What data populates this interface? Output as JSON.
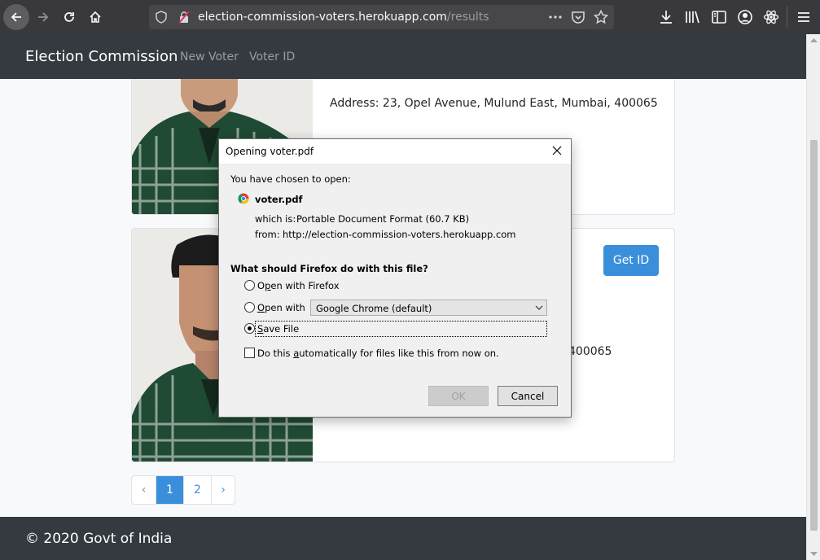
{
  "browser": {
    "url_host": "election-commission-voters.herokuapp.com",
    "url_path": "/results"
  },
  "navbar": {
    "brand": "Election Commission",
    "links": [
      "New Voter",
      "Voter ID"
    ]
  },
  "cards": [
    {
      "address": "Address: 23, Opel Avenue, Mulund East, Mumbai, 400065"
    },
    {
      "get_id_label": "Get ID",
      "address_tail": "400065"
    }
  ],
  "pagination": {
    "prev": "‹",
    "pages": [
      "1",
      "2"
    ],
    "active_page": "1",
    "next": "›"
  },
  "footer": {
    "text": "© 2020 Govt of India"
  },
  "dialog": {
    "title": "Opening voter.pdf",
    "chosen_text": "You have chosen to open:",
    "filename": "voter.pdf",
    "which_is_label": "which is:",
    "which_is_value": "Portable Document Format (60.7 KB)",
    "from_label": "from:",
    "from_value": "http://election-commission-voters.herokuapp.com",
    "question": "What should Firefox do with this file?",
    "option_open_firefox_pre": "O",
    "option_open_firefox_ul": "p",
    "option_open_firefox_post": "en with Firefox",
    "option_open_with_ul": "O",
    "option_open_with_post": "pen with",
    "app_selected": "Google Chrome (default)",
    "option_save_ul": "S",
    "option_save_post": "ave File",
    "selected_option": "Save File",
    "auto_pre": "Do this ",
    "auto_ul": "a",
    "auto_post": "utomatically for files like this from now on.",
    "auto_checked": false,
    "ok_label": "OK",
    "cancel_label": "Cancel"
  },
  "colors": {
    "navbar_bg": "#343a40",
    "primary": "#3a8fdb",
    "browser_bg": "#38383d"
  }
}
